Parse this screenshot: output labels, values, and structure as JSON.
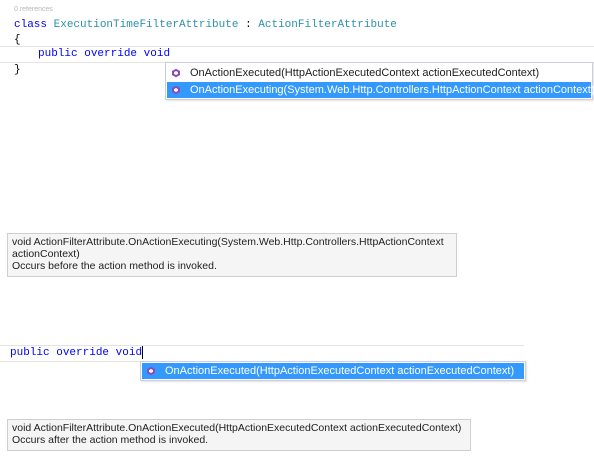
{
  "top_snippet": {
    "refs_text": "0 references",
    "class_keyword": "class",
    "class_name": "ExecutionTimeFilterAttribute",
    "separator": " : ",
    "base_name": "ActionFilterAttribute",
    "open_brace": "{",
    "line_public": "public",
    "line_override": "override",
    "line_void": "void",
    "close_brace": "}"
  },
  "completion_list_1": {
    "items": [
      {
        "label": "OnActionExecuted(HttpActionExecutedContext actionExecutedContext)",
        "icon": "method-icon",
        "selected": false
      },
      {
        "label": "OnActionExecuting(System.Web.Http.Controllers.HttpActionContext actionContext)",
        "icon": "method-icon",
        "selected": true
      }
    ]
  },
  "tooltip_1": {
    "signature_line1": "void ActionFilterAttribute.OnActionExecuting(System.Web.Http.Controllers.HttpActionContext",
    "signature_line2": "actionContext)",
    "description": "Occurs before the action method is invoked."
  },
  "bottom_snippet": {
    "line_public": "public",
    "line_override": "override",
    "line_void": "void"
  },
  "completion_list_2": {
    "items": [
      {
        "label": "OnActionExecuted(HttpActionExecutedContext actionExecutedContext)",
        "icon": "method-icon",
        "selected": true
      }
    ]
  },
  "tooltip_2": {
    "signature": "void ActionFilterAttribute.OnActionExecuted(HttpActionExecutedContext actionExecutedContext)",
    "description": "Occurs after the action method is invoked."
  },
  "colors": {
    "keyword": "#0000ff",
    "type": "#2b91af",
    "selection": "#3399ff",
    "method_icon": "#8a4bbf"
  }
}
